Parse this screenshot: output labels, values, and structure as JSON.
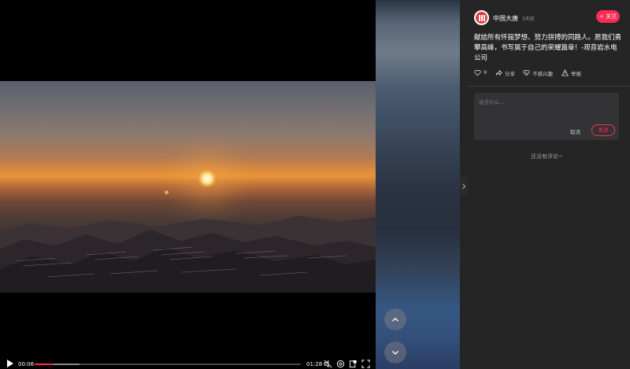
{
  "player": {
    "current_time": "00:06",
    "total_time": "01:28",
    "progress": 0.07,
    "buffered": 0.17,
    "controls": [
      "play-icon",
      "volume-muted-icon",
      "loop-icon",
      "picture-in-picture-icon",
      "fullscreen-icon"
    ]
  },
  "navigation": {
    "prev_icon": "chevron-up-icon",
    "next_icon": "chevron-down-icon",
    "collapse_icon": "chevron-right-icon"
  },
  "author": {
    "name": "中国大唐",
    "time": "3天前",
    "follow_label": "+ 关注"
  },
  "post": {
    "description": "献给所有怀揣梦想、努力拼搏的同路人。愿我们勇攀高峰，书写属于自己的荣耀篇章！-观音岩水电公司"
  },
  "actions": [
    {
      "icon": "heart-icon",
      "label": "9"
    },
    {
      "icon": "share-icon",
      "label": "分享"
    },
    {
      "icon": "not-interested-icon",
      "label": "不感兴趣"
    },
    {
      "icon": "report-icon",
      "label": "举报"
    }
  ],
  "comment": {
    "placeholder": "说点什么...",
    "cancel_label": "取消",
    "send_label": "发送",
    "empty_text": "还没有评论~"
  },
  "colors": {
    "accent": "#fe2c55",
    "panel_bg": "#252526",
    "input_bg": "#333335"
  }
}
